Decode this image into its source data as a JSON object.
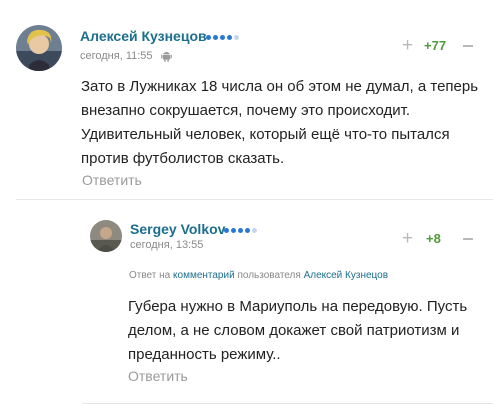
{
  "comments": [
    {
      "author": "Алексей Кузнецов",
      "time": "сегодня, 11:55",
      "device_icon": "android-icon",
      "rating_dots": {
        "filled": 4,
        "total": 5,
        "filled_color": "#2a79d0",
        "empty_color": "#c7d6e6"
      },
      "score": "+77",
      "text": "Зато в Лужниках 18 числа он об этом не думал, а теперь внезапно сокрушается, почему это происходит. Удивительный человек, который ещё что-то пытался против футболистов сказать.",
      "reply_label": "Ответить"
    },
    {
      "author": "Sergey Volkov",
      "time": "сегодня, 13:55",
      "rating_dots": {
        "filled": 4,
        "total": 5,
        "filled_color": "#2a79d0",
        "empty_color": "#c7d6e6"
      },
      "score": "+8",
      "reply_to": {
        "prefix": "Ответ на",
        "link": "комментарий",
        "middle": "пользователя",
        "user": "Алексей Кузнецов"
      },
      "text": "Губера нужно в Мариуполь на передовую. Пусть делом, а не словом докажет свой патриотизм и преданность режиму..",
      "reply_label": "Ответить"
    }
  ],
  "colors": {
    "author": "#1c6f8c",
    "score_positive": "#4e9b3a",
    "muted": "#9a9a9a"
  }
}
